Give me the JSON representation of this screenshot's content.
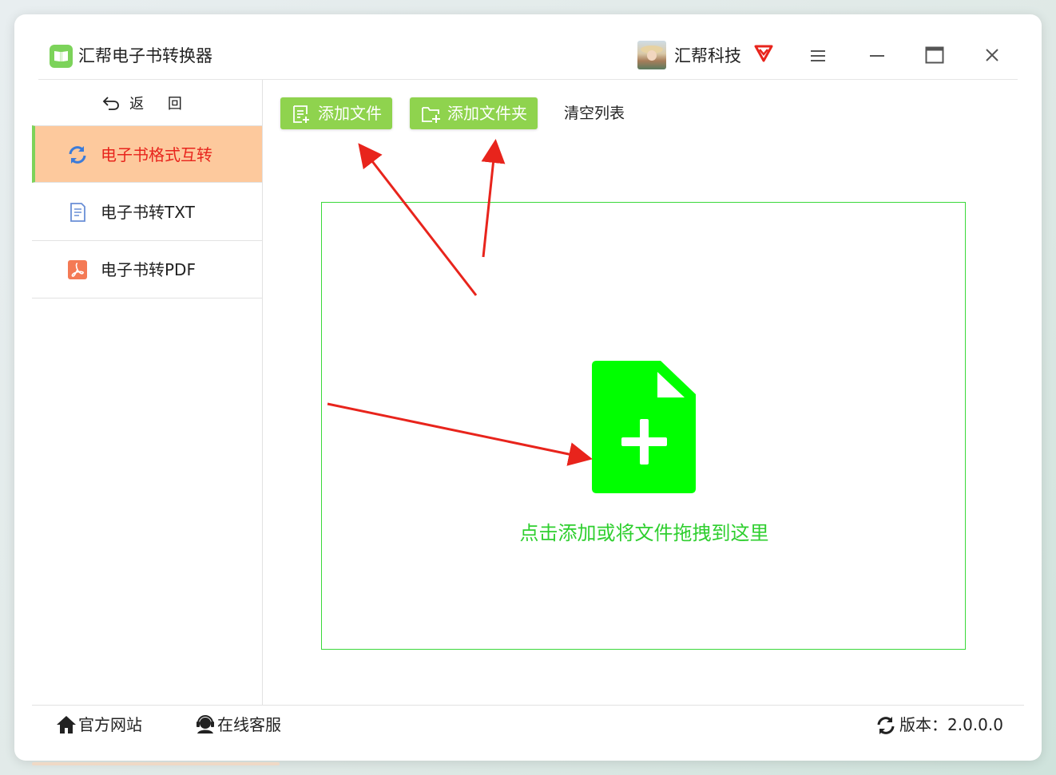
{
  "app": {
    "title": "汇帮电子书转换器",
    "username": "汇帮科技"
  },
  "colors": {
    "accent_green": "#8fd34e",
    "active_bg": "#fdc99d",
    "active_text": "#e8241c",
    "drop_green": "#00ff00",
    "arrow_red": "#e8241c"
  },
  "sidebar": {
    "back_label": "返 回",
    "items": [
      {
        "label": "电子书格式互转",
        "icon": "refresh-icon",
        "active": true
      },
      {
        "label": "电子书转TXT",
        "icon": "txt-file-icon",
        "active": false
      },
      {
        "label": "电子书转PDF",
        "icon": "pdf-icon",
        "active": false
      }
    ]
  },
  "toolbar": {
    "add_file": "添加文件",
    "add_folder": "添加文件夹",
    "clear_list": "清空列表"
  },
  "drop_zone": {
    "hint": "点击添加或将文件拖拽到这里"
  },
  "footer": {
    "official_site": "官方网站",
    "online_service": "在线客服",
    "version": "版本：2.0.0.0"
  }
}
